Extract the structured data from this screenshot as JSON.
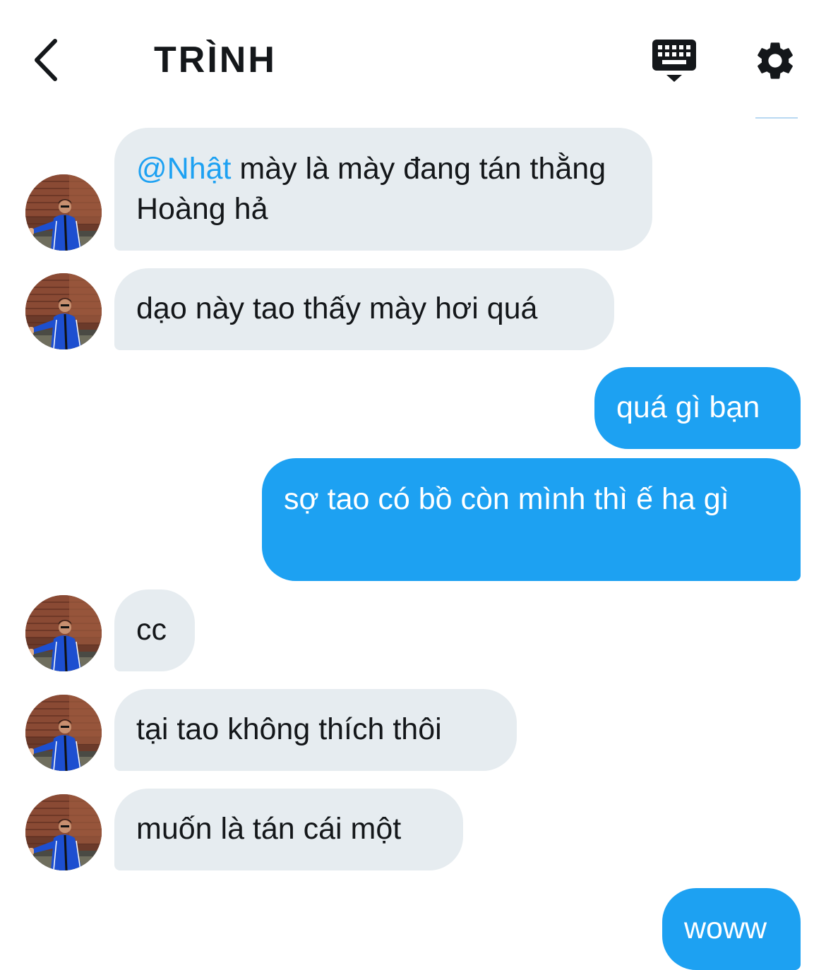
{
  "header": {
    "title": "TRÌNH",
    "back_icon": "chevron-left-icon",
    "keyboard_icon": "keyboard-icon",
    "settings_icon": "gear-icon"
  },
  "colors": {
    "incoming_bubble": "#e6ecf0",
    "outgoing_bubble": "#1da1f2",
    "mention": "#1da1f2"
  },
  "messages": [
    {
      "direction": "in",
      "mention": "@Nhật",
      "text": " mày là mày đang tán thằng Hoàng hả"
    },
    {
      "direction": "in",
      "text": "dạo này tao thấy mày hơi quá"
    },
    {
      "direction": "out",
      "text": "quá gì bạn"
    },
    {
      "direction": "out",
      "text": "sợ tao có bồ còn mình thì ế ha gì"
    },
    {
      "direction": "in",
      "text": "cc"
    },
    {
      "direction": "in",
      "text": "tại tao không thích thôi"
    },
    {
      "direction": "in",
      "text": "muốn là tán cái một"
    },
    {
      "direction": "out",
      "text": "woww"
    }
  ]
}
